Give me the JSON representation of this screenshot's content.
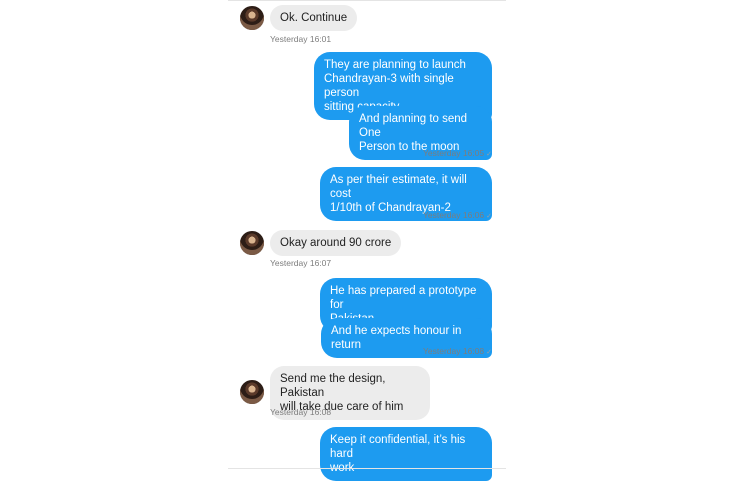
{
  "thread": {
    "messages": [
      {
        "side": "in",
        "text": "Ok. Continue",
        "time": "Yesterday 16:01"
      },
      {
        "side": "out",
        "text": "They are planning to launch\nChandrayan-3 with single person\nsitting capacity"
      },
      {
        "side": "out",
        "text": "And planning to send One\nPerson to the moon",
        "time": "Yesterday 16:05"
      },
      {
        "side": "out",
        "text": "As per their estimate, it will cost\n1/10th of Chandrayan-2",
        "time": "Yesterday 16:06"
      },
      {
        "side": "in",
        "text": "Okay around 90 crore",
        "time": "Yesterday 16:07"
      },
      {
        "side": "out",
        "text": "He has prepared a prototype for\nPakistan"
      },
      {
        "side": "out",
        "text": "And he expects honour in return",
        "time": "Yesterday 16:08"
      },
      {
        "side": "in",
        "text": "Send me the design, Pakistan\nwill take due care of him",
        "time": "Yesterday 16:08"
      },
      {
        "side": "out",
        "text": "Keep it confidential, it’s his hard\nwork"
      }
    ]
  },
  "icons": {
    "read_receipt": "checkmark-icon"
  }
}
